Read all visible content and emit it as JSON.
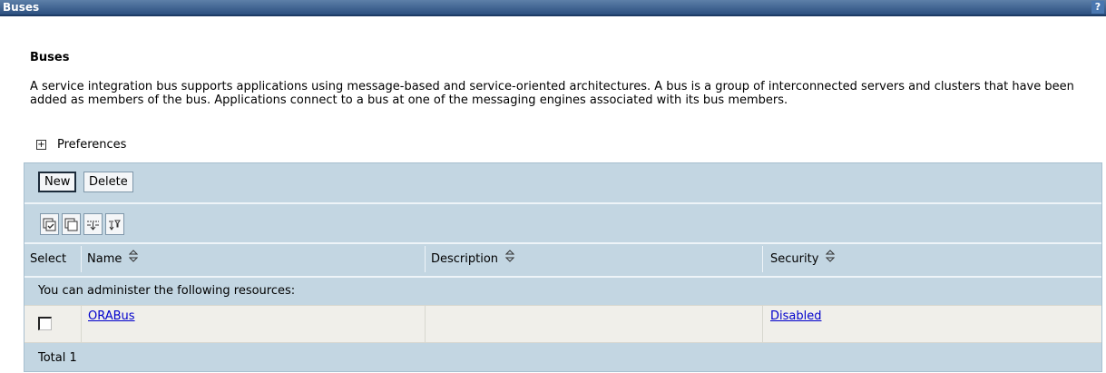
{
  "titlebar": {
    "title": "Buses",
    "help_label": "?"
  },
  "page": {
    "heading": "Buses",
    "description": "A service integration bus supports applications using message-based and service-oriented architectures. A bus is a group of interconnected servers and clusters that have been added as members of the bus. Applications connect to a bus at one of the messaging engines associated with its bus members."
  },
  "preferences": {
    "expand_icon": "+",
    "label": "Preferences"
  },
  "toolbar": {
    "new_label": "New",
    "delete_label": "Delete"
  },
  "icon_toolbar": [
    "select-all-icon",
    "deselect-all-icon",
    "expand-all-icon",
    "filter-icon"
  ],
  "table": {
    "columns": [
      "Select",
      "Name",
      "Description",
      "Security"
    ],
    "resources_message": "You can administer the following resources:",
    "rows": [
      {
        "name": "ORABus",
        "description": "",
        "security": "Disabled"
      }
    ],
    "total_label": "Total 1"
  },
  "colors": {
    "title_bar": "#2c5080",
    "panel": "#c3d6e2",
    "data_row": "#f0efea",
    "link": "#0000cc"
  }
}
